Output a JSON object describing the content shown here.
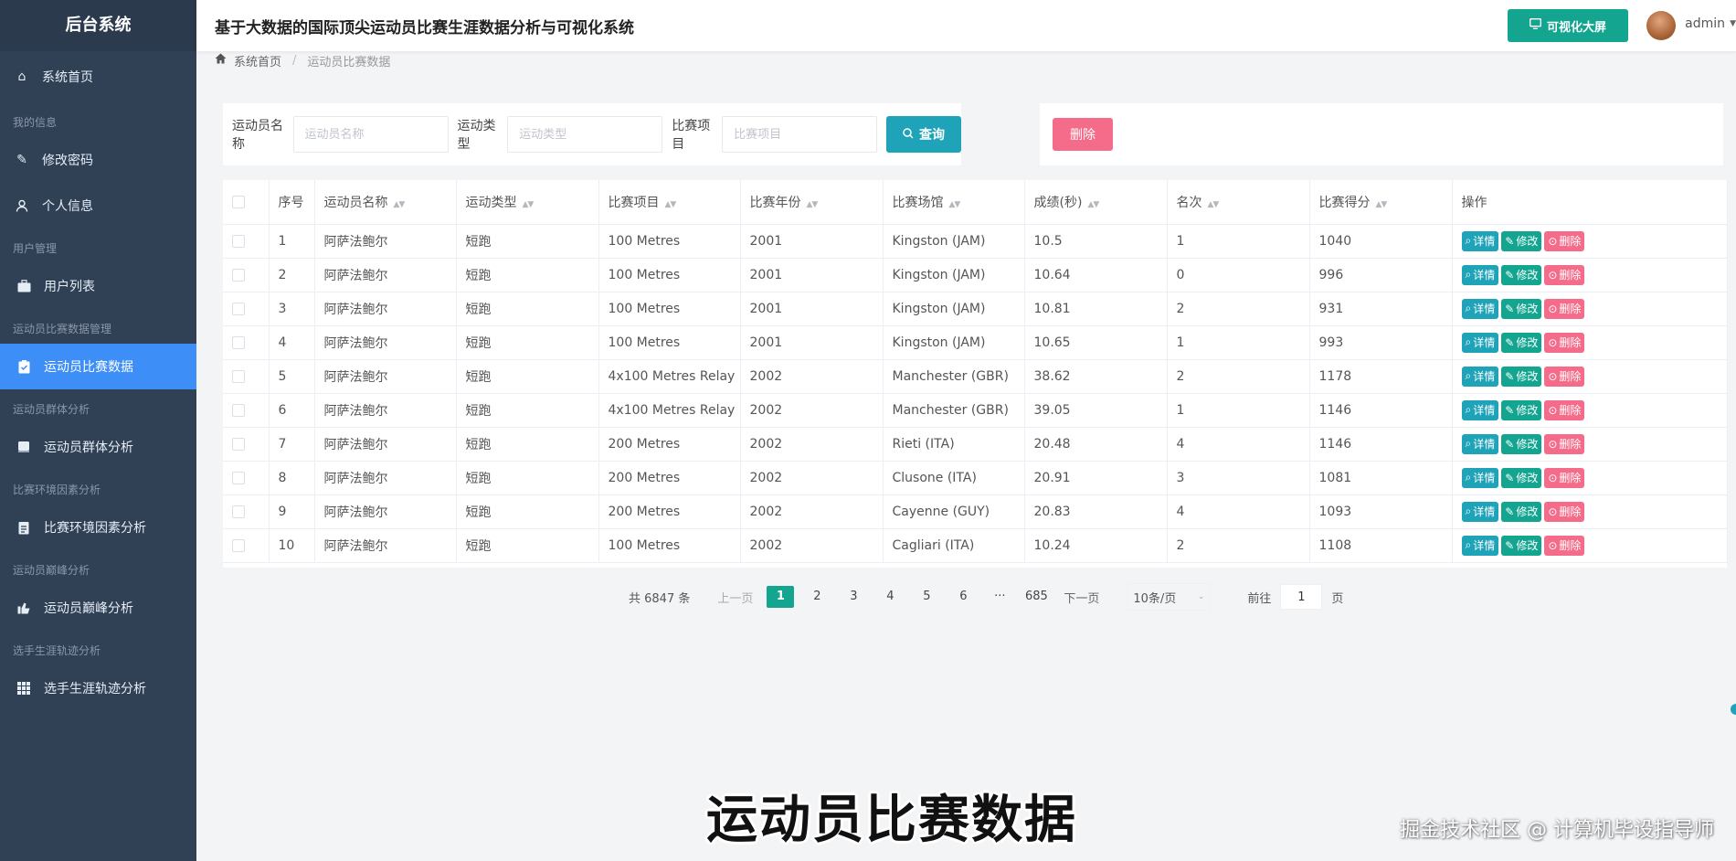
{
  "sidebar": {
    "brand": "后台系统",
    "home": "系统首页",
    "groups": [
      {
        "title": "我的信息",
        "items": [
          "修改密码",
          "个人信息"
        ]
      },
      {
        "title": "用户管理",
        "items": [
          "用户列表"
        ]
      },
      {
        "title": "运动员比赛数据管理",
        "items": [
          "运动员比赛数据"
        ]
      },
      {
        "title": "运动员群体分析",
        "items": [
          "运动员群体分析"
        ]
      },
      {
        "title": "比赛环境因素分析",
        "items": [
          "比赛环境因素分析"
        ]
      },
      {
        "title": "运动员巅峰分析",
        "items": [
          "运动员巅峰分析"
        ]
      },
      {
        "title": "选手生涯轨迹分析",
        "items": [
          "选手生涯轨迹分析"
        ]
      }
    ]
  },
  "header": {
    "title": "基于大数据的国际顶尖运动员比赛生涯数据分析与可视化系统",
    "screen_button": "可视化大屏",
    "user": "admin"
  },
  "breadcrumb": {
    "home": "系统首页",
    "current": "运动员比赛数据"
  },
  "search": {
    "name_label": "运动员名称",
    "name_placeholder": "运动员名称",
    "type_label": "运动类型",
    "type_placeholder": "运动类型",
    "event_label": "比赛项目",
    "event_placeholder": "比赛项目",
    "query": "查询"
  },
  "actions": {
    "delete": "删除"
  },
  "table": {
    "headers": [
      "序号",
      "运动员名称",
      "运动类型",
      "比赛项目",
      "比赛年份",
      "比赛场馆",
      "成绩(秒)",
      "名次",
      "比赛得分",
      "操作"
    ],
    "op_labels": {
      "detail": "详情",
      "edit": "修改",
      "remove": "删除"
    },
    "rows": [
      [
        "1",
        "阿萨法鲍尔",
        "短跑",
        "100 Metres",
        "2001",
        "Kingston (JAM)",
        "10.5",
        "1",
        "1040"
      ],
      [
        "2",
        "阿萨法鲍尔",
        "短跑",
        "100 Metres",
        "2001",
        "Kingston (JAM)",
        "10.64",
        "0",
        "996"
      ],
      [
        "3",
        "阿萨法鲍尔",
        "短跑",
        "100 Metres",
        "2001",
        "Kingston (JAM)",
        "10.81",
        "2",
        "931"
      ],
      [
        "4",
        "阿萨法鲍尔",
        "短跑",
        "100 Metres",
        "2001",
        "Kingston (JAM)",
        "10.65",
        "1",
        "993"
      ],
      [
        "5",
        "阿萨法鲍尔",
        "短跑",
        "4x100 Metres Relay",
        "2002",
        "Manchester (GBR)",
        "38.62",
        "2",
        "1178"
      ],
      [
        "6",
        "阿萨法鲍尔",
        "短跑",
        "4x100 Metres Relay",
        "2002",
        "Manchester (GBR)",
        "39.05",
        "1",
        "1146"
      ],
      [
        "7",
        "阿萨法鲍尔",
        "短跑",
        "200 Metres",
        "2002",
        "Rieti (ITA)",
        "20.48",
        "4",
        "1146"
      ],
      [
        "8",
        "阿萨法鲍尔",
        "短跑",
        "200 Metres",
        "2002",
        "Clusone (ITA)",
        "20.91",
        "3",
        "1081"
      ],
      [
        "9",
        "阿萨法鲍尔",
        "短跑",
        "200 Metres",
        "2002",
        "Cayenne (GUY)",
        "20.83",
        "4",
        "1093"
      ],
      [
        "10",
        "阿萨法鲍尔",
        "短跑",
        "100 Metres",
        "2002",
        "Cagliari (ITA)",
        "10.24",
        "2",
        "1108"
      ]
    ]
  },
  "pagination": {
    "total": "共 6847 条",
    "prev": "上一页",
    "pages": [
      "1",
      "2",
      "3",
      "4",
      "5",
      "6",
      "···",
      "685"
    ],
    "current": "1",
    "next": "下一页",
    "page_size": "10条/页",
    "goto_label": "前往",
    "goto_value": "1",
    "goto_unit": "页"
  },
  "overlay": {
    "caption": "运动员比赛数据",
    "watermark": "掘金技术社区 @ 计算机毕设指导师"
  },
  "colors": {
    "sidebar": "#304156",
    "active": "#3e8ef7",
    "teal": "#13a58f",
    "cyan": "#1fa3b8",
    "pink": "#f56c8a"
  }
}
